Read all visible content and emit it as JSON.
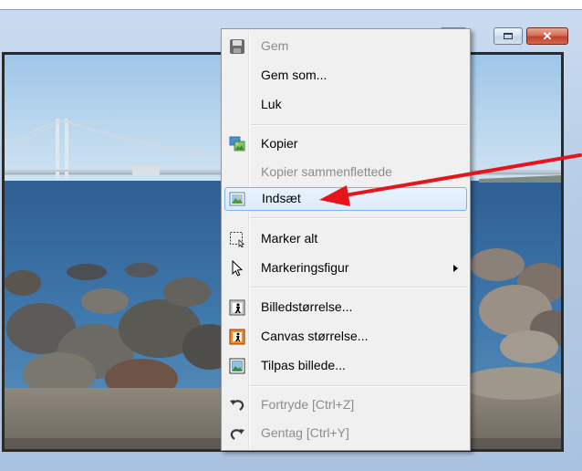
{
  "window": {
    "title_buttons": {
      "minimize": "minimize",
      "maximize": "maximize-icon",
      "close": "✕"
    }
  },
  "menu": {
    "items": [
      {
        "label": "Gem",
        "icon": "save-icon",
        "disabled": true
      },
      {
        "label": "Gem som...",
        "icon": "",
        "disabled": false
      },
      {
        "label": "Luk",
        "icon": "",
        "disabled": false
      },
      {
        "label": "Kopier",
        "icon": "copy-image-icon",
        "disabled": false
      },
      {
        "label": "Kopier sammenflettede",
        "icon": "",
        "disabled": true
      },
      {
        "label": "Indsæt",
        "icon": "paste-image-icon",
        "disabled": false,
        "highlighted": true
      },
      {
        "label": "Marker alt",
        "icon": "select-all-icon",
        "disabled": false
      },
      {
        "label": "Markeringsfigur",
        "icon": "cursor-arrow-icon",
        "disabled": false,
        "submenu": true
      },
      {
        "label": "Billedstørrelse...",
        "icon": "image-size-icon",
        "disabled": false
      },
      {
        "label": "Canvas størrelse...",
        "icon": "canvas-size-icon",
        "disabled": false
      },
      {
        "label": "Tilpas billede...",
        "icon": "fit-image-icon",
        "disabled": false
      },
      {
        "label": "Fortryde [Ctrl+Z]",
        "icon": "undo-icon",
        "disabled": true
      },
      {
        "label": "Gentag [Ctrl+Y]",
        "icon": "redo-icon",
        "disabled": true
      }
    ]
  },
  "annotation": {
    "color": "#e8141b",
    "points_to": "Indsæt"
  }
}
